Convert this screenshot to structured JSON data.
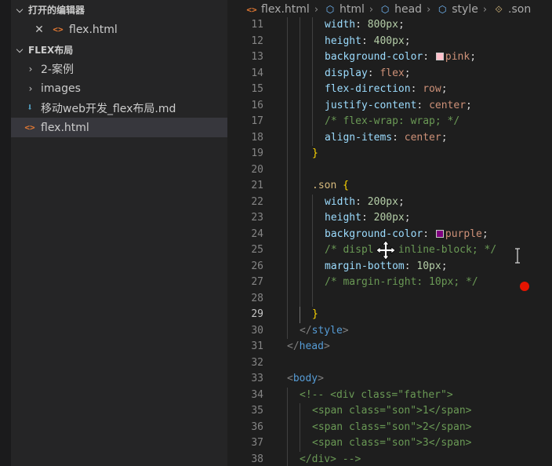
{
  "sidebar": {
    "open_editors": {
      "title": "打开的编辑器",
      "files": [
        {
          "name": "flex.html",
          "icon": "html-file-icon",
          "close_icon": "close-icon"
        }
      ]
    },
    "folder": {
      "title": "FLEX布局",
      "items": [
        {
          "name": "2-案例",
          "type": "folder",
          "icon": "chevron-right-icon"
        },
        {
          "name": "images",
          "type": "folder",
          "icon": "chevron-right-icon"
        },
        {
          "name": "移动web开发_flex布局.md",
          "type": "file",
          "icon": "markdown-file-icon"
        },
        {
          "name": "flex.html",
          "type": "file",
          "icon": "html-file-icon",
          "selected": true
        }
      ]
    }
  },
  "breadcrumb": {
    "items": [
      {
        "label": "flex.html",
        "icon": "html-file-icon"
      },
      {
        "label": "html",
        "icon": "cube-icon"
      },
      {
        "label": "head",
        "icon": "cube-icon"
      },
      {
        "label": "style",
        "icon": "cube-icon"
      },
      {
        "label": ".son",
        "icon": "selector-icon"
      }
    ]
  },
  "editor": {
    "current_line": 29,
    "lines": [
      {
        "n": 11,
        "guides": [
          0,
          1,
          2
        ],
        "tokens": [
          [
            "prop",
            "width"
          ],
          [
            "def",
            ": "
          ],
          [
            "num",
            "800px"
          ],
          [
            "def",
            ";"
          ]
        ]
      },
      {
        "n": 12,
        "guides": [
          0,
          1,
          2
        ],
        "tokens": [
          [
            "prop",
            "height"
          ],
          [
            "def",
            ": "
          ],
          [
            "num",
            "400px"
          ],
          [
            "def",
            ";"
          ]
        ]
      },
      {
        "n": 13,
        "guides": [
          0,
          1,
          2
        ],
        "tokens": [
          [
            "prop",
            "background-color"
          ],
          [
            "def",
            ": "
          ],
          [
            "swatch",
            "#ffc0cb"
          ],
          [
            "kw",
            "pink"
          ],
          [
            "def",
            ";"
          ]
        ]
      },
      {
        "n": 14,
        "guides": [
          0,
          1,
          2
        ],
        "tokens": [
          [
            "prop",
            "display"
          ],
          [
            "def",
            ": "
          ],
          [
            "kw",
            "flex"
          ],
          [
            "def",
            ";"
          ]
        ]
      },
      {
        "n": 15,
        "guides": [
          0,
          1,
          2
        ],
        "tokens": [
          [
            "prop",
            "flex-direction"
          ],
          [
            "def",
            ": "
          ],
          [
            "kw",
            "row"
          ],
          [
            "def",
            ";"
          ]
        ]
      },
      {
        "n": 16,
        "guides": [
          0,
          1,
          2
        ],
        "tokens": [
          [
            "prop",
            "justify-content"
          ],
          [
            "def",
            ": "
          ],
          [
            "kw",
            "center"
          ],
          [
            "def",
            ";"
          ]
        ]
      },
      {
        "n": 17,
        "guides": [
          0,
          1,
          2
        ],
        "tokens": [
          [
            "cm",
            "/* flex-wrap: wrap; */"
          ]
        ]
      },
      {
        "n": 18,
        "guides": [
          0,
          1,
          2
        ],
        "tokens": [
          [
            "prop",
            "align-items"
          ],
          [
            "def",
            ": "
          ],
          [
            "kw",
            "center"
          ],
          [
            "def",
            ";"
          ]
        ]
      },
      {
        "n": 19,
        "guides": [
          0,
          1
        ],
        "tokens": [
          [
            "br1",
            "}"
          ]
        ]
      },
      {
        "n": 20,
        "guides": [
          0,
          1
        ],
        "tokens": []
      },
      {
        "n": 21,
        "guides": [
          0,
          1
        ],
        "tokens": [
          [
            "sel",
            ".son"
          ],
          [
            "def",
            " "
          ],
          [
            "br1",
            "{"
          ]
        ]
      },
      {
        "n": 22,
        "guides": [
          0,
          1,
          2
        ],
        "tokens": [
          [
            "prop",
            "width"
          ],
          [
            "def",
            ": "
          ],
          [
            "num",
            "200px"
          ],
          [
            "def",
            ";"
          ]
        ]
      },
      {
        "n": 23,
        "guides": [
          0,
          1,
          2
        ],
        "tokens": [
          [
            "prop",
            "height"
          ],
          [
            "def",
            ": "
          ],
          [
            "num",
            "200px"
          ],
          [
            "def",
            ";"
          ]
        ]
      },
      {
        "n": 24,
        "guides": [
          0,
          1,
          2
        ],
        "tokens": [
          [
            "prop",
            "background-color"
          ],
          [
            "def",
            ": "
          ],
          [
            "swatch",
            "#800080"
          ],
          [
            "kw",
            "purple"
          ],
          [
            "def",
            ";"
          ]
        ]
      },
      {
        "n": 25,
        "guides": [
          0,
          1,
          2
        ],
        "tokens": [
          [
            "cm",
            "/* displ    inline-block; */"
          ]
        ]
      },
      {
        "n": 26,
        "guides": [
          0,
          1,
          2
        ],
        "tokens": [
          [
            "prop",
            "margin-bottom"
          ],
          [
            "def",
            ": "
          ],
          [
            "num",
            "10px"
          ],
          [
            "def",
            ";"
          ]
        ]
      },
      {
        "n": 27,
        "guides": [
          0,
          1,
          2
        ],
        "tokens": [
          [
            "cm",
            "/* margin-right: 10px; */"
          ]
        ]
      },
      {
        "n": 28,
        "guides": [
          0,
          1,
          2
        ],
        "tokens": []
      },
      {
        "n": 29,
        "guides": [
          0,
          1
        ],
        "active_guide": 1,
        "tokens": [
          [
            "br1",
            "}"
          ]
        ]
      },
      {
        "n": 30,
        "guides": [
          0
        ],
        "tokens": [
          [
            "punc",
            "</"
          ],
          [
            "tag",
            "style"
          ],
          [
            "punc",
            ">"
          ]
        ]
      },
      {
        "n": 31,
        "guides": [],
        "tokens": [
          [
            "punc",
            "</"
          ],
          [
            "tag",
            "head"
          ],
          [
            "punc",
            ">"
          ]
        ]
      },
      {
        "n": 32,
        "guides": [],
        "tokens": []
      },
      {
        "n": 33,
        "guides": [],
        "tokens": [
          [
            "punc",
            "<"
          ],
          [
            "tag",
            "body"
          ],
          [
            "punc",
            ">"
          ]
        ]
      },
      {
        "n": 34,
        "guides": [
          0
        ],
        "tokens": [
          [
            "cm",
            "<!-- <div class=\"father\">"
          ]
        ]
      },
      {
        "n": 35,
        "guides": [
          0,
          1
        ],
        "tokens": [
          [
            "cm",
            "<span class=\"son\">1</span>"
          ]
        ]
      },
      {
        "n": 36,
        "guides": [
          0,
          1
        ],
        "tokens": [
          [
            "cm",
            "<span class=\"son\">2</span>"
          ]
        ]
      },
      {
        "n": 37,
        "guides": [
          0,
          1
        ],
        "tokens": [
          [
            "cm",
            "<span class=\"son\">3</span>"
          ]
        ]
      },
      {
        "n": 38,
        "guides": [
          0
        ],
        "tokens": [
          [
            "cm",
            "</div> -->"
          ]
        ]
      }
    ]
  },
  "overlays": {
    "move_cursor": "move-cursor-icon",
    "text_cursor": "i-beam-cursor-icon",
    "indicator": {
      "icon": "red-dot-icon",
      "color": "#e51400"
    }
  }
}
